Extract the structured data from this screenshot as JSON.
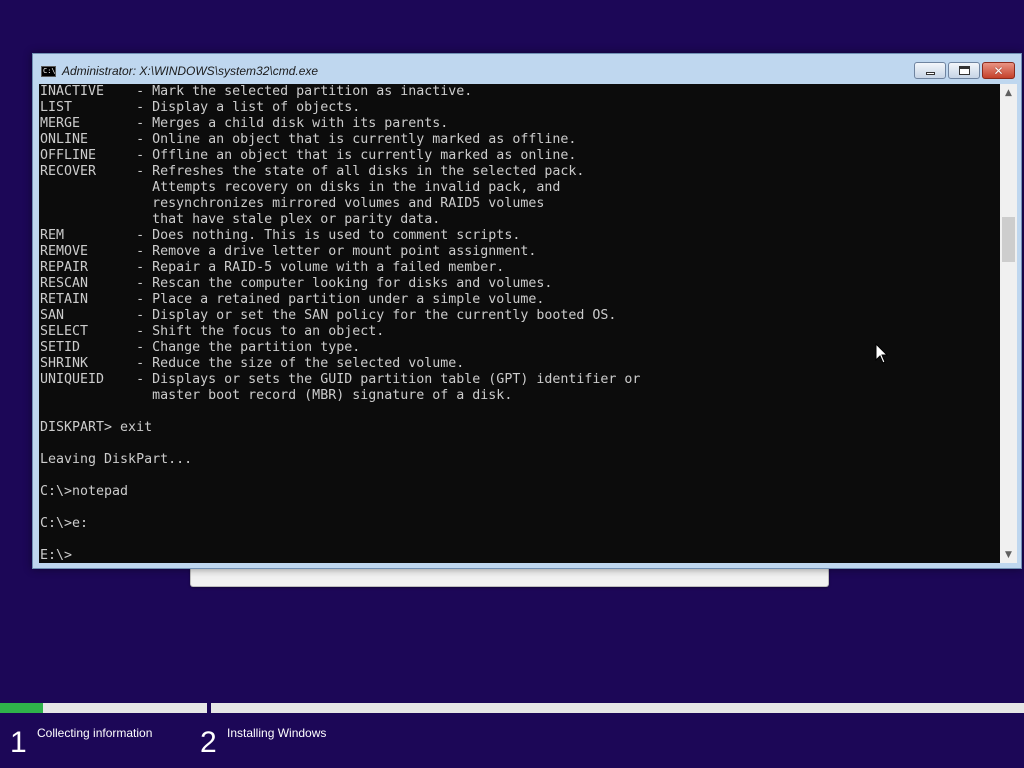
{
  "window": {
    "title": "Administrator: X:\\WINDOWS\\system32\\cmd.exe",
    "app_icon_text": "C:\\",
    "buttons": {
      "minimize": "minimize",
      "maximize": "maximize",
      "close": "✕"
    }
  },
  "console": {
    "lines": [
      "INACTIVE    - Mark the selected partition as inactive.",
      "LIST        - Display a list of objects.",
      "MERGE       - Merges a child disk with its parents.",
      "ONLINE      - Online an object that is currently marked as offline.",
      "OFFLINE     - Offline an object that is currently marked as online.",
      "RECOVER     - Refreshes the state of all disks in the selected pack.",
      "              Attempts recovery on disks in the invalid pack, and",
      "              resynchronizes mirrored volumes and RAID5 volumes",
      "              that have stale plex or parity data.",
      "REM         - Does nothing. This is used to comment scripts.",
      "REMOVE      - Remove a drive letter or mount point assignment.",
      "REPAIR      - Repair a RAID-5 volume with a failed member.",
      "RESCAN      - Rescan the computer looking for disks and volumes.",
      "RETAIN      - Place a retained partition under a simple volume.",
      "SAN         - Display or set the SAN policy for the currently booted OS.",
      "SELECT      - Shift the focus to an object.",
      "SETID       - Change the partition type.",
      "SHRINK      - Reduce the size of the selected volume.",
      "UNIQUEID    - Displays or sets the GUID partition table (GPT) identifier or",
      "              master boot record (MBR) signature of a disk.",
      "",
      "DISKPART> exit",
      "",
      "Leaving DiskPart...",
      "",
      "C:\\>notepad",
      "",
      "C:\\>e:",
      "",
      "E:\\>"
    ]
  },
  "scrollbar": {
    "position": 0.28
  },
  "setup": {
    "steps": [
      {
        "number": "1",
        "label": "Collecting information",
        "progress": 0.21
      },
      {
        "number": "2",
        "label": "Installing Windows",
        "progress": 0
      }
    ]
  },
  "colors": {
    "desktop": "#1c0757",
    "console_bg": "#0c0c0c",
    "console_text": "#cccccc",
    "progress": "#2fb24a"
  }
}
